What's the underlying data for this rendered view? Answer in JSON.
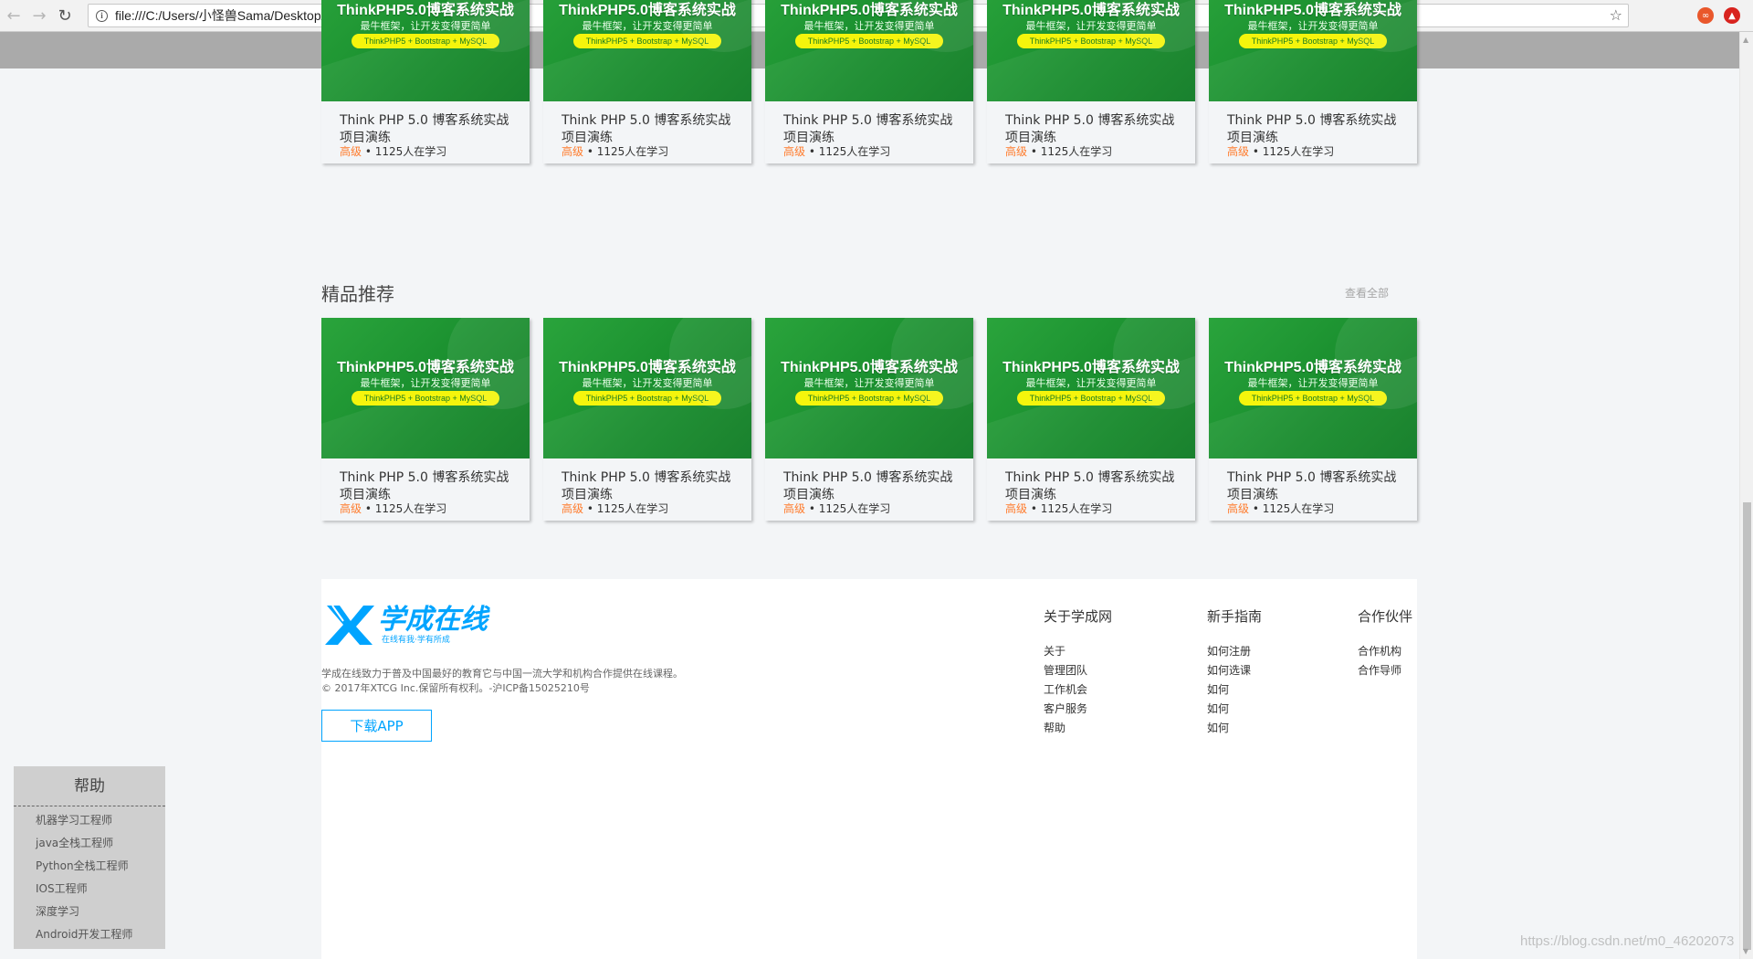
{
  "browser": {
    "url": "file:///C:/Users/小怪兽Sama/Desktop/HTML+CSS/study/index.html",
    "back_icon": "arrow-left",
    "forward_icon": "arrow-right",
    "reload_icon": "reload"
  },
  "course_card": {
    "thumb_title": "ThinkPHP5.0博客系统实战",
    "thumb_subtitle": "最牛框架，让开发变得更简单",
    "thumb_pill": "ThinkPHP5 + Bootstrap + MySQL",
    "title": "Think PHP 5.0 博客系统实战项目演练",
    "level": "高级",
    "separator": " • ",
    "learners": "1125人在学习"
  },
  "sections": {
    "featured_title": "精品推荐",
    "view_all": "查看全部"
  },
  "footer": {
    "logo_text": "学成在线",
    "logo_slogan": "在线有我·学有所成",
    "desc_line1": "学成在线致力于普及中国最好的教育它与中国一流大学和机构合作提供在线课程。",
    "desc_line2": "© 2017年XTCG Inc.保留所有权利。-沪ICP备15025210号",
    "download_label": "下载APP",
    "columns": [
      {
        "title": "关于学成网",
        "links": [
          "关于",
          "管理团队",
          "工作机会",
          "客户服务",
          "帮助"
        ]
      },
      {
        "title": "新手指南",
        "links": [
          "如何注册",
          "如何选课",
          "如何",
          "如何",
          "如何"
        ]
      },
      {
        "title": "合作伙伴",
        "links": [
          "合作机构",
          "合作导师"
        ]
      }
    ]
  },
  "help": {
    "title": "帮助",
    "items": [
      "机器学习工程师",
      "java全栈工程师",
      "Python全栈工程师",
      "IOS工程师",
      "深度学习",
      "Android开发工程师"
    ]
  },
  "watermark": "https://blog.csdn.net/m0_46202073",
  "colors": {
    "accent": "#00a4ff",
    "level": "#ff7c2d",
    "thumb_green": "#1f9633"
  }
}
